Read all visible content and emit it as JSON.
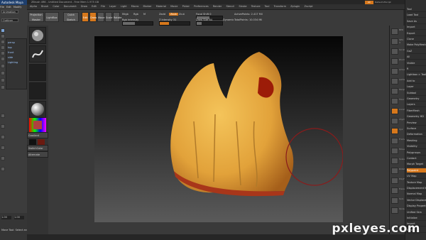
{
  "maya": {
    "title": "Autodesk Maya",
    "menu": [
      "File",
      "Edit",
      "Modify"
    ],
    "mode": "Animation",
    "panel_mode": "Outliner",
    "outliner": [
      "persp",
      "top",
      "front",
      "side",
      "Lighting"
    ],
    "bottom_fields": [
      "1.00",
      "1.00"
    ],
    "bottom_label": "Move Tool: Select an"
  },
  "zbrush": {
    "title": "ZBrush 4R6 - Untitled Document - Free Mem 1.975 GB",
    "menu": [
      "Alpha",
      "Brush",
      "Color",
      "Document",
      "Draw",
      "Edit",
      "File",
      "Layer",
      "Light",
      "Macro",
      "Marker",
      "Material",
      "Movie",
      "Picker",
      "Preferences",
      "Render",
      "Stencil",
      "Stroke",
      "Texture",
      "Tool",
      "Transform",
      "Zplugin",
      "Zscript"
    ],
    "shelf": {
      "projection_master": "Projection Master",
      "lightbox": "LightBox",
      "quick_sketch": "Quick Sketch",
      "edit": "Edit",
      "draw": "Draw",
      "move": "Move",
      "scale": "Scale",
      "rotate": "Rotate",
      "mrgb": "Mrgb",
      "rgb": "Rgb",
      "m": "M",
      "zadd": "Zadd",
      "zsub": "Zsub",
      "zcut": "Zcut",
      "rgb_intensity": "Rgb Intensity",
      "z_intensity": "Z Intensity 31",
      "focal_shift": "Focal Shift 0",
      "draw_size": "Draw Size 64",
      "dynamic": "Dynamic",
      "active_points": "ActivePoints: 2.417 Mil",
      "total_points": "TotalPoints: 10.034 Mil"
    },
    "left_palette": [
      "Gradient",
      "SwitchColor",
      "Alternate"
    ],
    "right_shelf": [
      "BPR",
      "SPix 3",
      "Scroll",
      "Zoom",
      "Actual",
      "AAHalf",
      "Persp",
      "Floor",
      "Local",
      "LSym",
      "Xyz",
      "Frame",
      "Move",
      "Scale",
      "Rotate",
      "PolyF",
      "Transp",
      "Solo",
      "Xpose"
    ],
    "top_right": {
      "ac": "AC",
      "label": "Default ZScript"
    },
    "tool_panel": [
      "Tool",
      "Load Tool",
      "Save As",
      "Import",
      "Export",
      "Clone",
      "Make PolyMesh3D",
      "GoZ",
      "All",
      "Visible",
      "R",
      "Lightbox > Tools",
      "Add to",
      "Layer",
      "Subtool",
      "Geometry",
      "Layers",
      "FiberMesh",
      "Geometry HD",
      "Preview",
      "Surface",
      "Deformation",
      "Masking",
      "Visibility",
      "Polygroups",
      "Contact",
      "Morph Target",
      "Polypaint",
      "UV Map",
      "Texture Map",
      "Displacement Map",
      "Normal Map",
      "Vector Displacement",
      "Display Properties",
      "Unified Skin",
      "Initialize",
      "Import",
      "Export"
    ],
    "highlighted_tool_item": "Polypaint"
  },
  "watermark": "pxleyes.com"
}
